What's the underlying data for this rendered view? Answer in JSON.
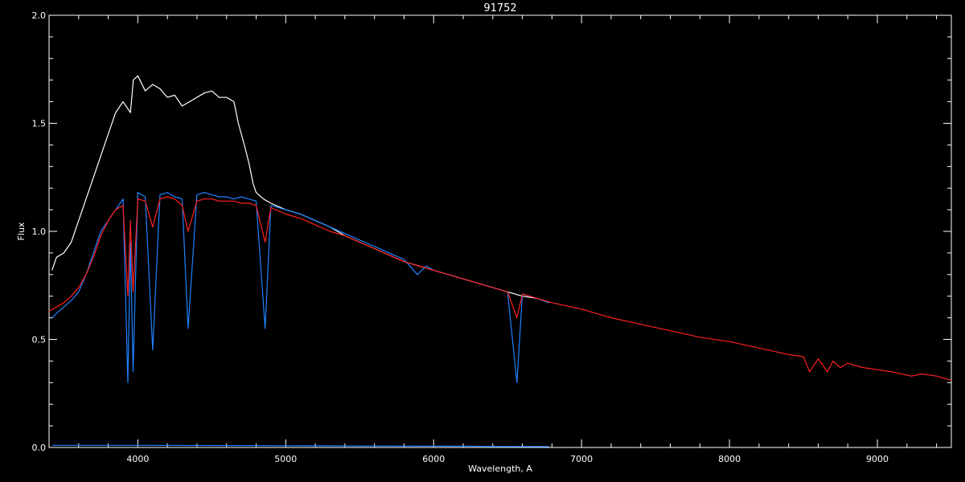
{
  "chart_data": {
    "type": "line",
    "title": "91752",
    "xlabel": "Wavelength, A",
    "ylabel": "Flux",
    "xlim": [
      3400,
      9500
    ],
    "ylim": [
      0,
      2.0
    ],
    "x_ticks": [
      4000,
      5000,
      6000,
      7000,
      8000,
      9000
    ],
    "x_tick_labels": [
      "4000",
      "5000",
      "6000",
      "7000",
      "8000",
      "9000"
    ],
    "y_ticks": [
      0.0,
      0.5,
      1.0,
      1.5,
      2.0
    ],
    "y_tick_labels": [
      "0.0",
      "0.5",
      "1.0",
      "1.5",
      "2.0"
    ],
    "background": "#000000",
    "foreground": "#ffffff",
    "series": [
      {
        "color": "#ffffff",
        "x": [
          3420,
          3450,
          3500,
          3550,
          3600,
          3650,
          3700,
          3750,
          3800,
          3850,
          3900,
          3950,
          3970,
          4000,
          4050,
          4100,
          4150,
          4200,
          4250,
          4300,
          4350,
          4400,
          4450,
          4500,
          4550,
          4600,
          4650,
          4680,
          4700,
          4720,
          4750,
          4780,
          4800,
          4850,
          4900,
          5000,
          5100,
          5200,
          5300,
          5400,
          5500,
          5600,
          5700,
          5800,
          5900,
          6000,
          6100,
          6200,
          6300,
          6400,
          6500,
          6600,
          6700,
          6780
        ],
        "y": [
          0.82,
          0.88,
          0.9,
          0.95,
          1.05,
          1.15,
          1.25,
          1.35,
          1.45,
          1.55,
          1.6,
          1.55,
          1.7,
          1.72,
          1.65,
          1.68,
          1.66,
          1.62,
          1.63,
          1.58,
          1.6,
          1.62,
          1.64,
          1.65,
          1.62,
          1.62,
          1.6,
          1.5,
          1.45,
          1.4,
          1.32,
          1.22,
          1.18,
          1.15,
          1.13,
          1.1,
          1.08,
          1.05,
          1.02,
          0.98,
          0.95,
          0.92,
          0.89,
          0.86,
          0.84,
          0.82,
          0.8,
          0.78,
          0.76,
          0.74,
          0.72,
          0.7,
          0.69,
          0.67
        ]
      },
      {
        "color": "#1e82ff",
        "x": [
          3420,
          3450,
          3500,
          3550,
          3600,
          3650,
          3700,
          3750,
          3800,
          3850,
          3900,
          3933,
          3950,
          3968,
          4000,
          4050,
          4101,
          4150,
          4200,
          4250,
          4300,
          4340,
          4400,
          4450,
          4500,
          4550,
          4600,
          4650,
          4700,
          4750,
          4800,
          4861,
          4900,
          5000,
          5100,
          5200,
          5300,
          5400,
          5500,
          5600,
          5700,
          5800,
          5890,
          5950,
          6000,
          6100,
          6200,
          6300,
          6400,
          6500,
          6563,
          6600,
          6700,
          6780
        ],
        "y": [
          0.6,
          0.62,
          0.65,
          0.68,
          0.72,
          0.8,
          0.9,
          1.0,
          1.05,
          1.1,
          1.15,
          0.3,
          0.95,
          0.35,
          1.18,
          1.16,
          0.45,
          1.17,
          1.18,
          1.16,
          1.15,
          0.55,
          1.17,
          1.18,
          1.17,
          1.16,
          1.16,
          1.15,
          1.16,
          1.15,
          1.14,
          0.55,
          1.12,
          1.1,
          1.08,
          1.05,
          1.02,
          0.99,
          0.96,
          0.93,
          0.9,
          0.87,
          0.8,
          0.84,
          0.82,
          0.8,
          0.78,
          0.76,
          0.74,
          0.72,
          0.3,
          0.71,
          0.69,
          0.67
        ]
      },
      {
        "color": "#ff2020",
        "x": [
          3400,
          3450,
          3500,
          3550,
          3600,
          3650,
          3700,
          3750,
          3800,
          3850,
          3900,
          3933,
          3950,
          3968,
          4000,
          4050,
          4101,
          4150,
          4200,
          4250,
          4300,
          4340,
          4400,
          4450,
          4500,
          4550,
          4600,
          4650,
          4700,
          4750,
          4800,
          4861,
          4900,
          5000,
          5100,
          5200,
          5300,
          5400,
          5500,
          5600,
          5700,
          5800,
          5900,
          6000,
          6100,
          6200,
          6300,
          6400,
          6500,
          6563,
          6600,
          6700,
          6800,
          7000,
          7200,
          7400,
          7600,
          7800,
          8000,
          8200,
          8400,
          8500,
          8542,
          8600,
          8662,
          8700,
          8750,
          8800,
          8900,
          9000,
          9100,
          9229,
          9300,
          9400,
          9500
        ],
        "y": [
          0.63,
          0.65,
          0.67,
          0.7,
          0.74,
          0.8,
          0.88,
          0.98,
          1.05,
          1.1,
          1.12,
          0.7,
          1.05,
          0.72,
          1.15,
          1.14,
          1.02,
          1.15,
          1.16,
          1.15,
          1.12,
          1.0,
          1.14,
          1.15,
          1.15,
          1.14,
          1.14,
          1.14,
          1.13,
          1.13,
          1.12,
          0.95,
          1.11,
          1.08,
          1.06,
          1.03,
          1.0,
          0.98,
          0.95,
          0.92,
          0.89,
          0.86,
          0.84,
          0.82,
          0.8,
          0.78,
          0.76,
          0.74,
          0.72,
          0.6,
          0.71,
          0.69,
          0.67,
          0.64,
          0.6,
          0.57,
          0.54,
          0.51,
          0.49,
          0.46,
          0.43,
          0.42,
          0.35,
          0.41,
          0.35,
          0.4,
          0.37,
          0.39,
          0.37,
          0.36,
          0.35,
          0.33,
          0.34,
          0.33,
          0.31
        ]
      },
      {
        "color": "#1e82ff",
        "x": [
          3420,
          4000,
          5000,
          6000,
          6780
        ],
        "y": [
          0.01,
          0.01,
          0.008,
          0.006,
          0.004
        ]
      }
    ]
  }
}
